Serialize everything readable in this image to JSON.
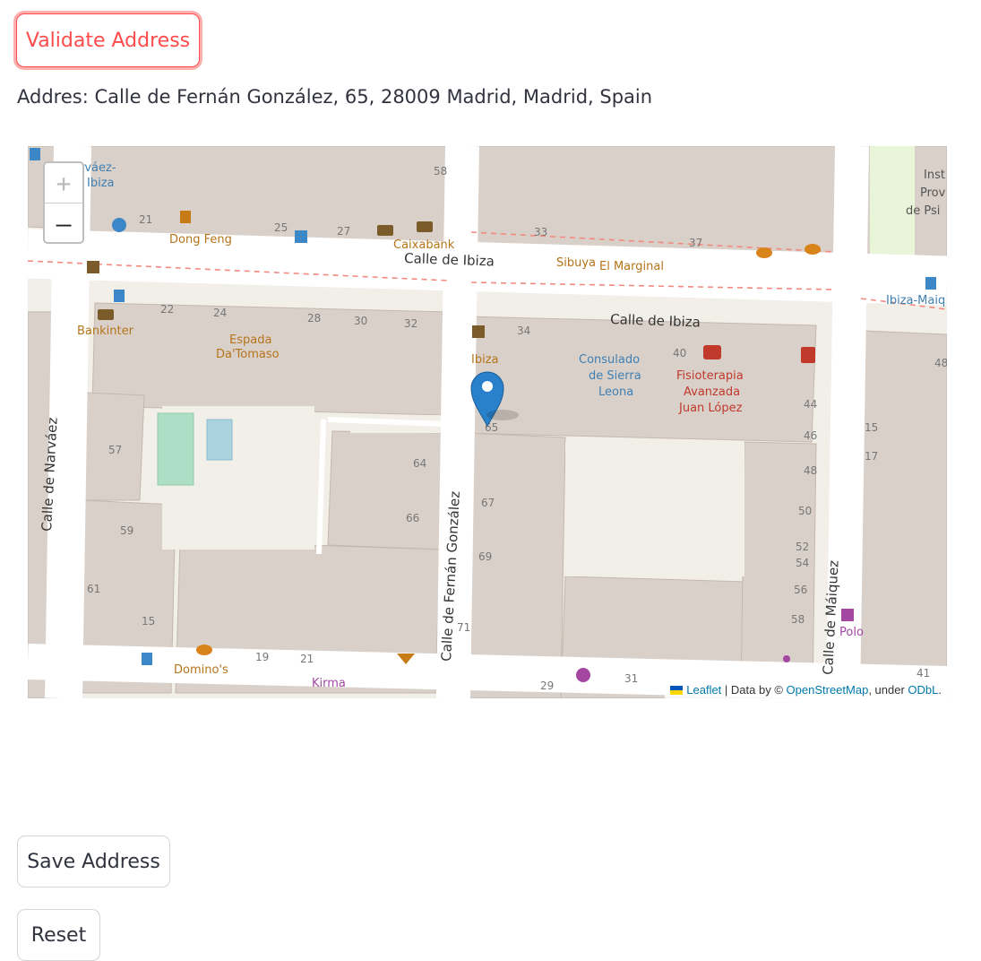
{
  "buttons": {
    "validate": "Validate Address",
    "save": "Save Address",
    "reset": "Reset"
  },
  "address_text": "Addres: Calle de Fernán González, 65, 28009 Madrid, Madrid, Spain",
  "map": {
    "zoom_in": "+",
    "zoom_out": "–",
    "attribution": {
      "leaflet": "Leaflet",
      "middle": " | Data by © ",
      "osm": "OpenStreetMap",
      "under": ", under ",
      "odbl": "ODbL",
      "end": "."
    },
    "streets": {
      "ibiza_1": "Calle de Ibiza",
      "ibiza_2": "Calle de Ibiza",
      "narvaez": "Calle de Narváez",
      "fernan": "Calle de Fernán González",
      "maiquez": "Calle de Máiquez"
    },
    "pois": {
      "narvaez_ibiza": "Narváez-\nIbiza",
      "dong_feng": "Dong Feng",
      "caixabank": "Caixabank",
      "sibuya": "Sibuya",
      "el_marginal": "El Marginal",
      "bankinter": "Bankinter",
      "espada": "Espada\nDa'Tomaso",
      "ibiza": "Ibiza",
      "consulado": "Consulado\nde Sierra\nLeona",
      "fisioterapia": "Fisioterapia\nAvanzada\nJuan López",
      "dominos": "Domino's",
      "kirma": "Kirma",
      "polo": "Polo",
      "ibiza_maiquez": "Ibiza-Maiq",
      "inst": "Inst\nProv\nde Psi"
    },
    "house_numbers": [
      "58",
      "21",
      "25",
      "27",
      "33",
      "37",
      "22",
      "24",
      "28",
      "30",
      "32",
      "34",
      "40",
      "48",
      "65",
      "44",
      "46",
      "48",
      "50",
      "52",
      "54",
      "56",
      "58",
      "57",
      "64",
      "66",
      "67",
      "69",
      "59",
      "61",
      "15",
      "19",
      "21",
      "71",
      "29",
      "31",
      "41",
      "15",
      "17"
    ]
  },
  "colors": {
    "accent": "#ff4b4b",
    "map_land": "#f2efe9",
    "building": "#d9d0c9",
    "road": "#ffffff",
    "marker": "#2a81cb"
  }
}
